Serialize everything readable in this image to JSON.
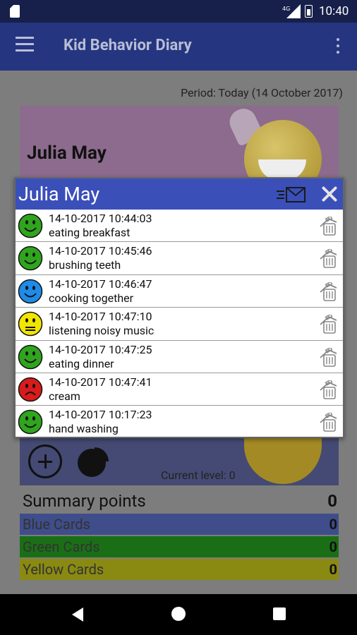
{
  "status_bar": {
    "time": "10:40",
    "network": "4G"
  },
  "app_bar": {
    "title": "Kid Behavior Diary"
  },
  "main": {
    "period": "Period: Today (14 October 2017)",
    "child_name": "Julia May",
    "current_level": "Current level: 0",
    "summary_label": "Summary points",
    "summary_value": "0",
    "cards": [
      {
        "label": "Blue Cards",
        "value": "0"
      },
      {
        "label": "Green Cards",
        "value": "0"
      },
      {
        "label": "Yellow Cards",
        "value": "0"
      }
    ]
  },
  "dialog": {
    "title": "Julia May",
    "entries": [
      {
        "time": "14-10-2017 10:44:03",
        "text": "eating breakfast",
        "face": "green-smile-icon"
      },
      {
        "time": "14-10-2017 10:45:46",
        "text": "brushing teeth",
        "face": "green-smile-icon"
      },
      {
        "time": "14-10-2017 10:46:47",
        "text": "cooking together",
        "face": "blue-smile-icon"
      },
      {
        "time": "14-10-2017 10:47:10",
        "text": "listening noisy music",
        "face": "yellow-neutral-icon"
      },
      {
        "time": "14-10-2017 10:47:25",
        "text": "eating dinner",
        "face": "green-smile-icon"
      },
      {
        "time": "14-10-2017 10:47:41",
        "text": "cream",
        "face": "red-sad-icon"
      },
      {
        "time": "14-10-2017 10:17:23",
        "text": "hand washing",
        "face": "green-smile-icon"
      }
    ]
  },
  "colors": {
    "app_bar": "#253580",
    "dialog_header": "#3b4fb9",
    "green_face": "#2fa51e",
    "blue_face": "#1e8be8",
    "yellow_face": "#f2e600",
    "red_face": "#d81b1b"
  }
}
